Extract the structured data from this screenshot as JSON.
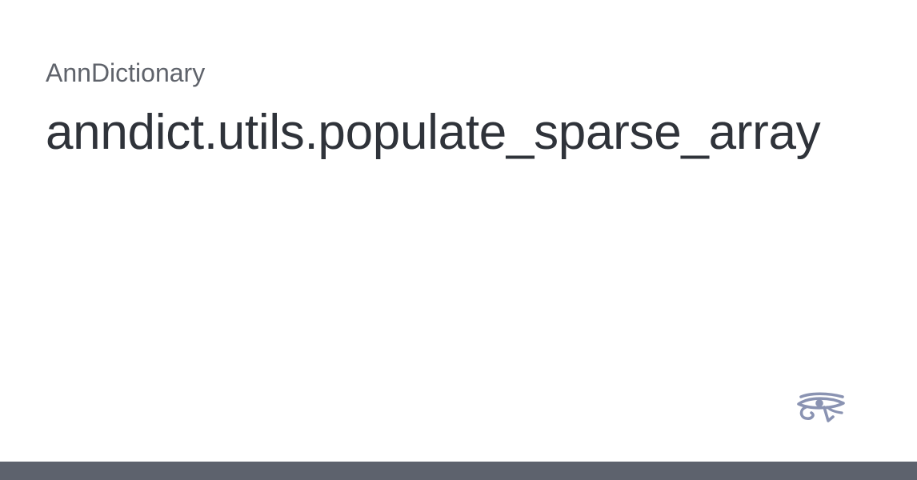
{
  "project": {
    "name": "AnnDictionary"
  },
  "page": {
    "title": "anndict.utils.populate_sparse_array"
  },
  "logo": {
    "icon": "eye-of-horus-icon",
    "color": "#8a93b2"
  },
  "footer": {
    "color": "#5d626d"
  }
}
